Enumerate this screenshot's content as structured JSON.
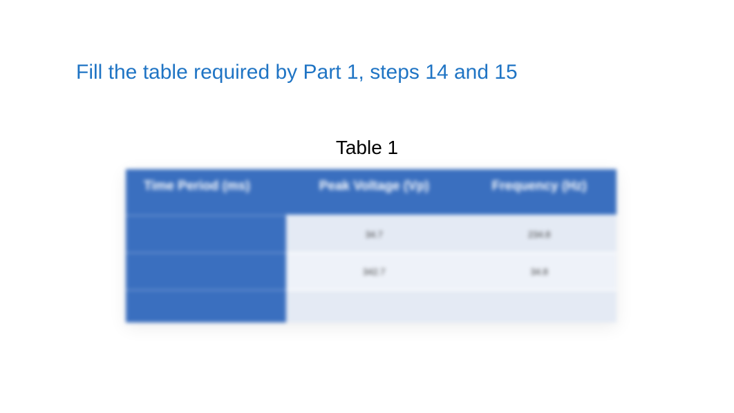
{
  "title": "Fill the table required by Part 1, steps 14 and 15",
  "table_label": "Table 1",
  "chart_data": {
    "type": "table",
    "headers": [
      "Time Period (ms)",
      "Peak Voltage (Vp)",
      "Frequency (Hz)"
    ],
    "rows": [
      {
        "time_period": "",
        "peak_voltage": "34.7",
        "frequency": "234.8"
      },
      {
        "time_period": "",
        "peak_voltage": "342.7",
        "frequency": "34.8"
      },
      {
        "time_period": "",
        "peak_voltage": "",
        "frequency": ""
      }
    ]
  }
}
